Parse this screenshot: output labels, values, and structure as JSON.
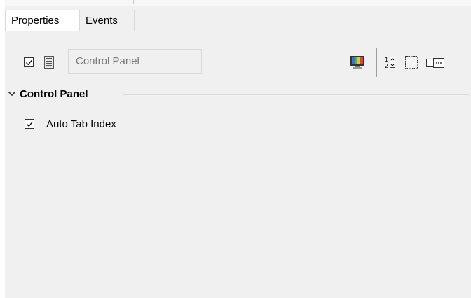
{
  "tabs": [
    {
      "label": "Properties",
      "active": true
    },
    {
      "label": "Events",
      "active": false
    }
  ],
  "toolbar": {
    "show_checkbox_checked": true,
    "component_name_value": "Control Panel",
    "icons": [
      "component-icon",
      "monitor-colors-icon",
      "tab-order-icon",
      "dotted-rectangle-icon",
      "toggle-button-icon"
    ]
  },
  "section": {
    "title": "Control Panel",
    "expanded": true,
    "properties": [
      {
        "label": "Auto Tab Index",
        "checked": true
      }
    ]
  },
  "colors": {
    "panel_bg": "#f0f0f0",
    "active_tab_bg": "#ffffff",
    "field_text": "#7a7a7a"
  }
}
